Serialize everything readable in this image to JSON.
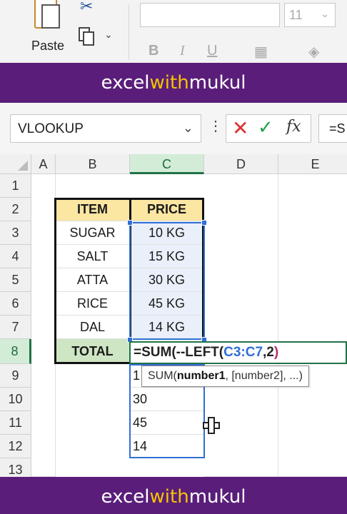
{
  "ribbon": {
    "paste_label": "Paste",
    "font_size": "11",
    "format_icons": [
      "bold-icon",
      "italic-icon",
      "underline-icon",
      "borders-icon",
      "fill-color-icon"
    ],
    "format_glyphs": {
      "bold": "B",
      "italic": "I",
      "underline": "U"
    }
  },
  "banner": {
    "prefix": "excel",
    "highlight": "with",
    "suffix": "mukul"
  },
  "formula_bar": {
    "name_box": "VLOOKUP",
    "cancel_glyph": "✕",
    "enter_glyph": "✓",
    "fx_label": "fx",
    "formula_visible": "=S"
  },
  "columns": [
    "A",
    "B",
    "C",
    "D",
    "E"
  ],
  "rows": [
    "1",
    "2",
    "3",
    "4",
    "5",
    "6",
    "7",
    "8",
    "9",
    "10",
    "11",
    "12",
    "13"
  ],
  "table": {
    "header_item": "ITEM",
    "header_price": "PRICE",
    "items": [
      {
        "item": "SUGAR",
        "price": "10 KG"
      },
      {
        "item": "SALT",
        "price": "15 KG"
      },
      {
        "item": "ATTA",
        "price": "30 KG"
      },
      {
        "item": "RICE",
        "price": "45 KG"
      },
      {
        "item": "DAL",
        "price": "14 KG"
      }
    ],
    "total_label": "TOTAL"
  },
  "edit_formula": {
    "part1": "=SUM(--LEFT(",
    "ref": "C3:C7",
    "part2": ",2",
    "close": ")"
  },
  "spill_values": [
    "1",
    "30",
    "45",
    "14"
  ],
  "tooltip": {
    "fn": "SUM(",
    "arg1": "number1",
    "rest": ", [number2], ...)"
  },
  "colors": {
    "banner_bg": "#5a1e7a",
    "banner_highlight": "#f5c400",
    "header_fill": "#fbe6a2",
    "total_fill": "#cfe6c4",
    "selection_blue": "#2f6fd6",
    "excel_green": "#217346"
  }
}
